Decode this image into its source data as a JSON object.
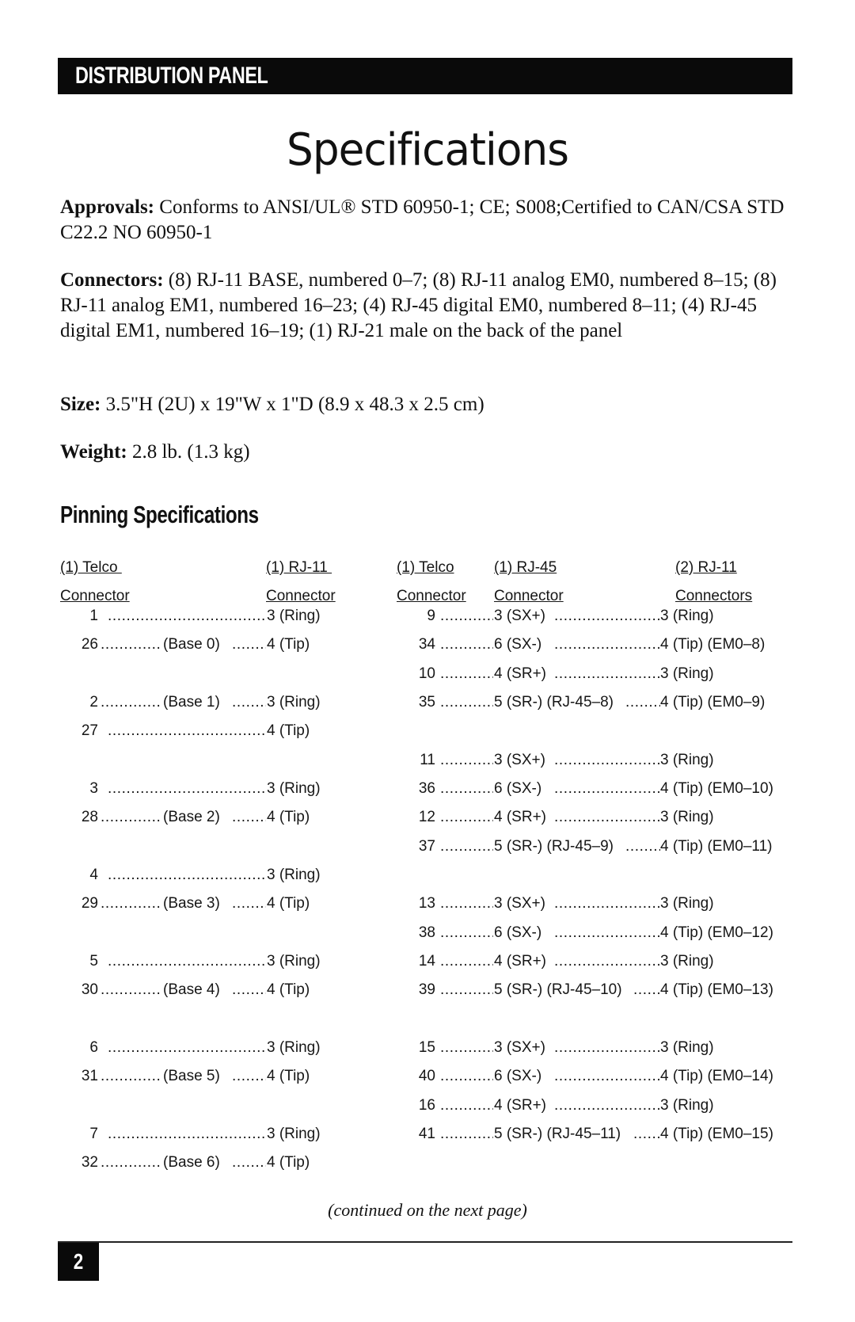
{
  "header": {
    "title": "DISTRIBUTION PANEL"
  },
  "page_title": "Specifications",
  "specs": [
    {
      "label": "Approvals:",
      "text": " Conforms to ANSI/UL® STD 60950-1; CE; S008;Certified to CAN/CSA STD C22.2 NO 60950-1"
    },
    {
      "label": "Connectors:",
      "text": " (8) RJ-11 BASE, numbered 0–7; (8) RJ-11 analog EM0, numbered 8–15; (8) RJ-11 analog EM1, numbered 16–23; (4) RJ-45 digital EM0, numbered 8–11; (4) RJ-45 digital EM1, numbered 16–19; (1) RJ-21 male on the back of the panel"
    },
    {
      "label": "Size:",
      "text": " 3.5\"H (2U) x 19\"W x 1\"D (8.9 x 48.3 x 2.5 cm)"
    },
    {
      "label": "Weight:",
      "text": " 2.8 lb. (1.3 kg)"
    }
  ],
  "pinning": {
    "title": "Pinning Specifications",
    "left_table": {
      "headers": [
        [
          "(1) Telco ",
          "(1) RJ-11 "
        ],
        [
          "Connector",
          "Connector"
        ]
      ],
      "rows": [
        {
          "telco": "1",
          "mid": "",
          "rj11": "3 (Ring)"
        },
        {
          "telco": "26",
          "mid": "(Base 0)",
          "rj11": "4 (Tip)"
        },
        {
          "telco": "2",
          "mid": "(Base 1)",
          "rj11": "3 (Ring)"
        },
        {
          "telco": "27",
          "mid": "",
          "rj11": "4 (Tip)"
        },
        {
          "telco": "3",
          "mid": "",
          "rj11": "3 (Ring)"
        },
        {
          "telco": "28",
          "mid": "(Base 2)",
          "rj11": "4 (Tip)"
        },
        {
          "telco": "4",
          "mid": "",
          "rj11": "3 (Ring)"
        },
        {
          "telco": "29",
          "mid": "(Base 3)",
          "rj11": "4 (Tip)"
        },
        {
          "telco": "5",
          "mid": "",
          "rj11": "3 (Ring)"
        },
        {
          "telco": "30",
          "mid": "(Base 4)",
          "rj11": "4 (Tip)"
        },
        {
          "telco": "6",
          "mid": "",
          "rj11": "3 (Ring)"
        },
        {
          "telco": "31",
          "mid": "(Base 5)",
          "rj11": "4 (Tip)"
        },
        {
          "telco": "7",
          "mid": "",
          "rj11": "3 (Ring)"
        },
        {
          "telco": "32",
          "mid": "(Base 6)",
          "rj11": "4 (Tip)"
        }
      ]
    },
    "right_table": {
      "headers": [
        [
          "(1) Telco",
          "(1) RJ-45",
          "(2) RJ-11"
        ],
        [
          "Connector",
          "Connector",
          "Connectors"
        ]
      ],
      "rows": [
        {
          "telco": "9",
          "rj45": "3 (SX+)",
          "rj11": "3 (Ring)"
        },
        {
          "telco": "34",
          "rj45": "6 (SX-) ",
          "rj11": "4 (Tip) (EM0–8)"
        },
        {
          "telco": "10",
          "rj45": "4 (SR+)",
          "rj11": "3 (Ring)"
        },
        {
          "telco": "35",
          "rj45": "5 (SR-) (RJ-45–8)",
          "rj11": "4 (Tip) (EM0–9)"
        },
        {
          "telco": "11",
          "rj45": "3 (SX+)",
          "rj11": "3 (Ring)"
        },
        {
          "telco": "36",
          "rj45": "6 (SX-) ",
          "rj11": "4 (Tip) (EM0–10)"
        },
        {
          "telco": "12",
          "rj45": "4 (SR+)",
          "rj11": "3 (Ring)"
        },
        {
          "telco": "37",
          "rj45": "5 (SR-) (RJ-45–9)",
          "rj11": "4 (Tip) (EM0–11)"
        },
        {
          "telco": "13",
          "rj45": "3 (SX+)",
          "rj11": "3 (Ring)"
        },
        {
          "telco": "38",
          "rj45": "6 (SX-) ",
          "rj11": "4 (Tip) (EM0–12)"
        },
        {
          "telco": "14",
          "rj45": "4 (SR+)",
          "rj11": "3 (Ring)"
        },
        {
          "telco": "39",
          "rj45": "5 (SR-) (RJ-45–10)",
          "rj11": "4 (Tip) (EM0–13)"
        },
        {
          "telco": "15",
          "rj45": "3 (SX+)",
          "rj11": "3 (Ring)"
        },
        {
          "telco": "40",
          "rj45": "6 (SX-) ",
          "rj11": "4 (Tip) (EM0–14)"
        },
        {
          "telco": "16",
          "rj45": "4 (SR+)",
          "rj11": "3 (Ring)"
        },
        {
          "telco": "41",
          "rj45": "5 (SR-) (RJ-45–11)",
          "rj11": "4 (Tip) (EM0–15)"
        }
      ]
    }
  },
  "continued_note": "(continued on the next page)",
  "footer": {
    "page_number": "2"
  }
}
